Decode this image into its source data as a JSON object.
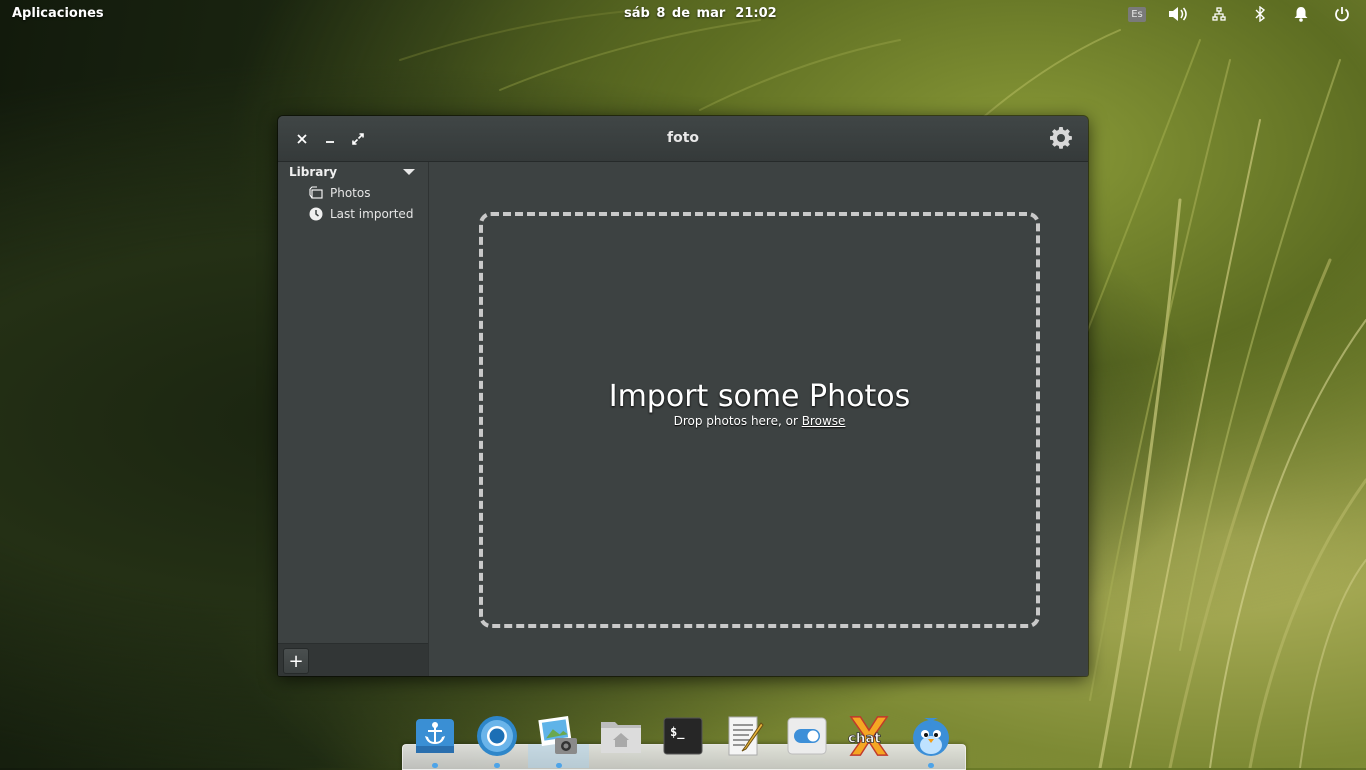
{
  "panel": {
    "applications_label": "Aplicaciones",
    "date": "sáb  8 de mar",
    "time": "21:02",
    "keyboard_layout": "Es",
    "icons": [
      "volume-icon",
      "network-icon",
      "bluetooth-icon",
      "notification-icon",
      "power-icon"
    ]
  },
  "window": {
    "title": "foto",
    "buttons": [
      "close-icon",
      "minimize-icon",
      "maximize-icon",
      "settings-gear-icon"
    ]
  },
  "sidebar": {
    "header": "Library",
    "items": [
      {
        "label": "Photos",
        "icon": "photos-icon"
      },
      {
        "label": "Last imported",
        "icon": "clock-icon"
      }
    ],
    "add_button": "+"
  },
  "content": {
    "title": "Import some Photos",
    "subtitle_prefix": "Drop photos here, or ",
    "browse_link": "Browse"
  },
  "dock": {
    "items": [
      "dock-settings-anchor-icon",
      "chromium-icon",
      "shotwell-photos-icon",
      "files-home-icon",
      "terminal-icon",
      "text-editor-icon",
      "switchboard-toggle-icon",
      "xchat-icon",
      "birdie-twitter-icon"
    ],
    "terminal_prompt": "$_",
    "chat_label": "chat",
    "accent": "#4ea4e8"
  }
}
